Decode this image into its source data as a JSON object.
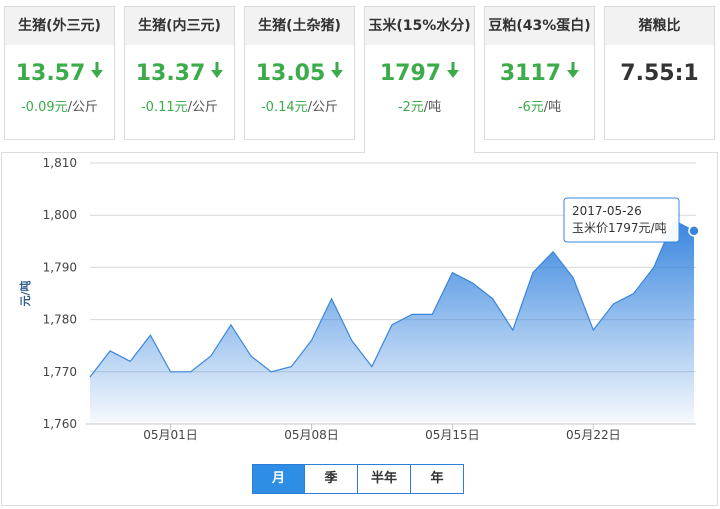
{
  "cards": [
    {
      "title": "生猪(外三元)",
      "value": "13.57",
      "change": "-0.09元",
      "unit": "/公斤",
      "trend": "down"
    },
    {
      "title": "生猪(内三元)",
      "value": "13.37",
      "change": "-0.11元",
      "unit": "/公斤",
      "trend": "down"
    },
    {
      "title": "生猪(土杂猪)",
      "value": "13.05",
      "change": "-0.14元",
      "unit": "/公斤",
      "trend": "down"
    },
    {
      "title": "玉米(15%水分)",
      "value": "1797",
      "change": "-2元",
      "unit": "/吨",
      "trend": "down",
      "active": true
    },
    {
      "title": "豆粕(43%蛋白)",
      "value": "3117",
      "change": "-6元",
      "unit": "/吨",
      "trend": "down"
    },
    {
      "title": "猪粮比",
      "value": "7.55:1",
      "change": "",
      "unit": "",
      "trend": "none"
    }
  ],
  "arrow_icon": "arrow-down-icon",
  "colors": {
    "down": "#3cab4a",
    "line": "#2e7dd7",
    "active_tab": "#2e8ee6"
  },
  "tooltip": {
    "date": "2017-05-26",
    "label": "玉米价1797元/吨"
  },
  "range_buttons": [
    {
      "label": "月",
      "active": true
    },
    {
      "label": "季",
      "active": false
    },
    {
      "label": "半年",
      "active": false
    },
    {
      "label": "年",
      "active": false
    }
  ],
  "chart_data": {
    "type": "area",
    "title": "",
    "xlabel": "",
    "ylabel": "元/吨",
    "ylim": [
      1760,
      1810
    ],
    "yticks": [
      1760,
      1770,
      1780,
      1790,
      1800,
      1810
    ],
    "ytick_labels": [
      "1,760",
      "1,770",
      "1,780",
      "1,790",
      "1,800",
      "1,810"
    ],
    "xtick_labels": [
      "05月01日",
      "05月08日",
      "05月15日",
      "05月22日"
    ],
    "xtick_positions": [
      4,
      11,
      18,
      25
    ],
    "grid": true,
    "series": [
      {
        "values": [
          1769,
          1774,
          1772,
          1777,
          1770,
          1770,
          1773,
          1779,
          1773,
          1770,
          1771,
          1776,
          1784,
          1776,
          1771,
          1779,
          1781,
          1781,
          1789,
          1787,
          1784,
          1778,
          1789,
          1793,
          1788,
          1778,
          1783,
          1785,
          1790,
          1799,
          1797
        ]
      }
    ]
  }
}
